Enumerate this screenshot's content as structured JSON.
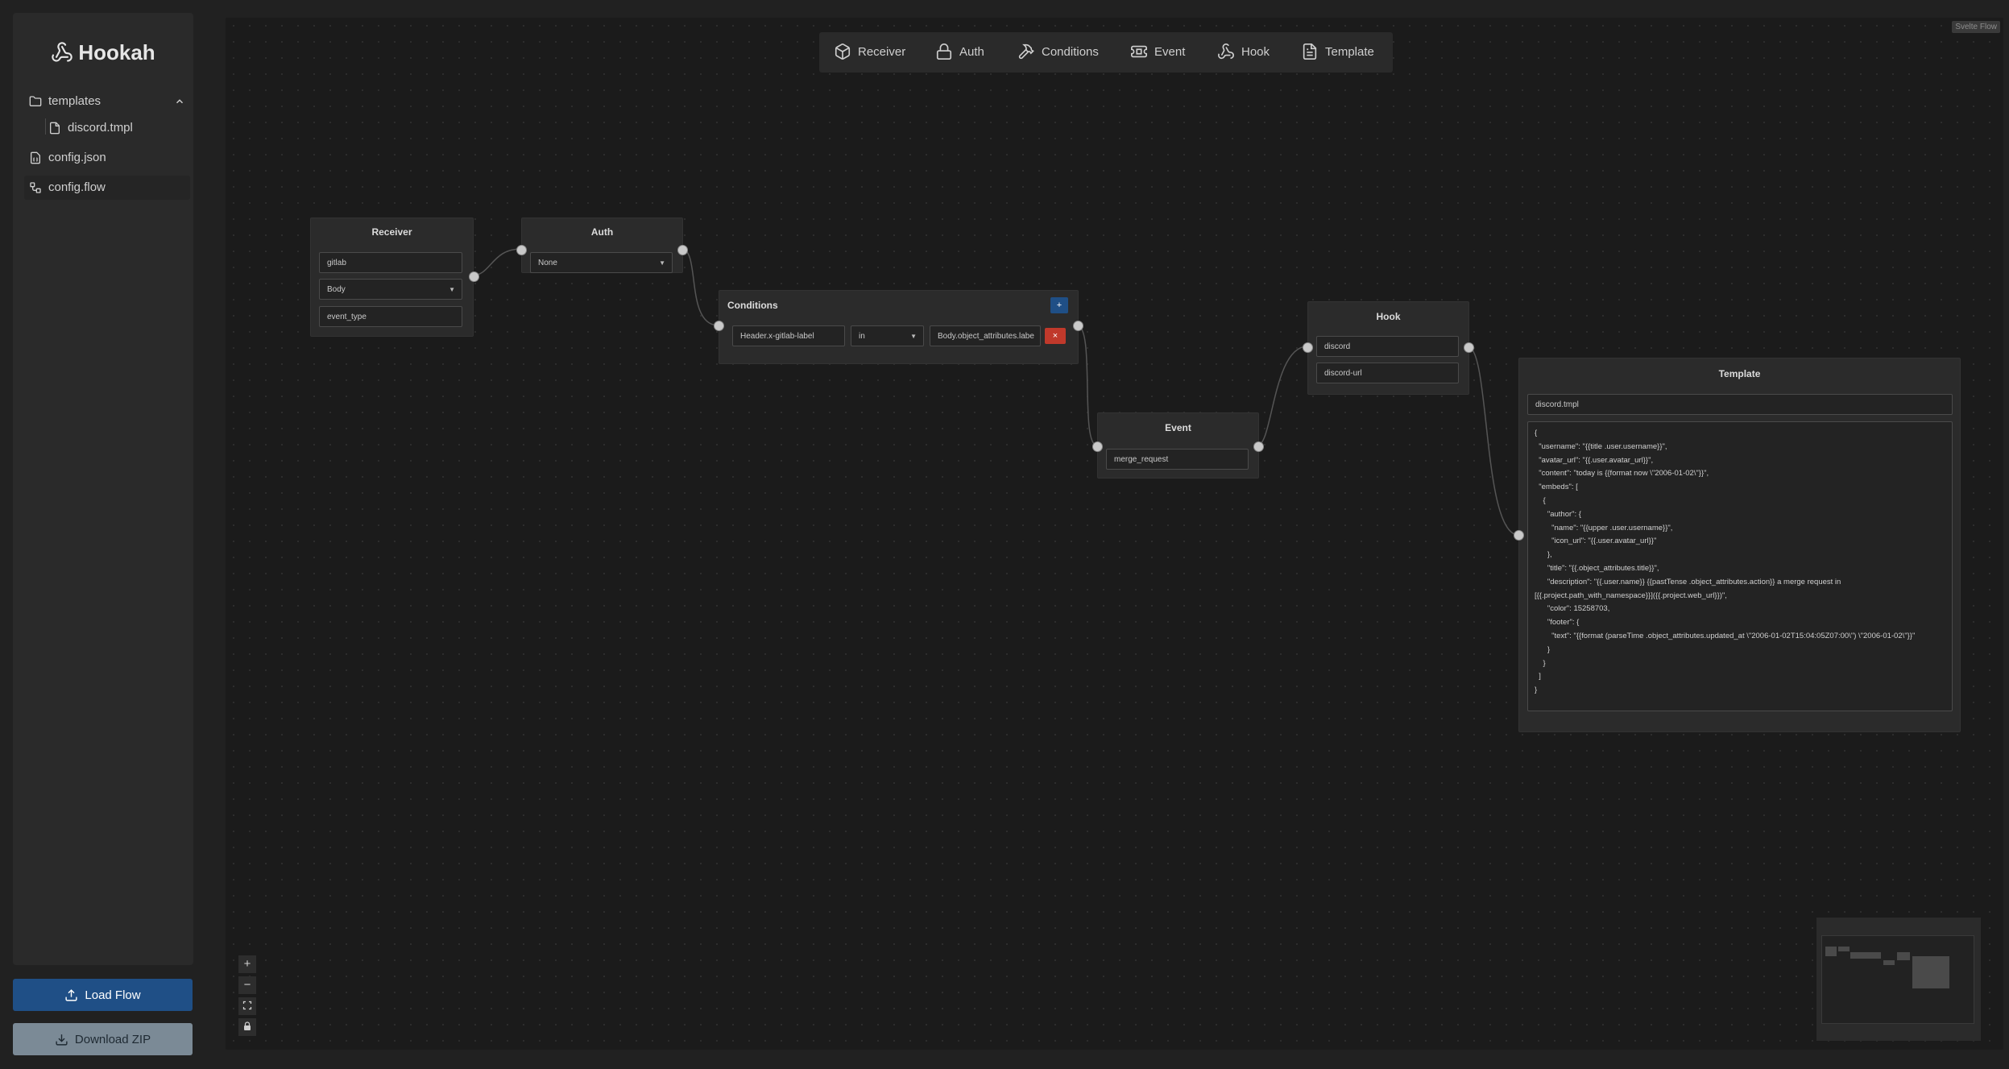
{
  "app": {
    "title": "Hookah"
  },
  "sidebar": {
    "tree": [
      {
        "label": "templates",
        "icon": "folder-icon",
        "expanded": true
      },
      {
        "label": "discord.tmpl",
        "icon": "file-icon"
      },
      {
        "label": "config.json",
        "icon": "file-json-icon"
      },
      {
        "label": "config.flow",
        "icon": "flow-icon",
        "active": true
      }
    ],
    "load_label": "Load Flow",
    "download_label": "Download ZIP"
  },
  "canvas": {
    "attribution": "Svelte Flow",
    "toolbar": [
      "Receiver",
      "Auth",
      "Conditions",
      "Event",
      "Hook",
      "Template"
    ],
    "controls": [
      "+",
      "−"
    ]
  },
  "nodes": {
    "receiver": {
      "title": "Receiver",
      "name": "gitlab",
      "source": "Body",
      "key": "event_type"
    },
    "auth": {
      "title": "Auth",
      "method": "None"
    },
    "conditions": {
      "title": "Conditions",
      "add": "+",
      "remove": "×",
      "left": "Header.x-gitlab-label",
      "op": "in",
      "right": "Body.object_attributes.labe"
    },
    "event": {
      "title": "Event",
      "value": "merge_request"
    },
    "hook": {
      "title": "Hook",
      "name": "discord",
      "url": "discord-url"
    },
    "template": {
      "title": "Template",
      "file": "discord.tmpl",
      "body": "{\n  \"username\": \"{{title .user.username}}\",\n  \"avatar_url\": \"{{.user.avatar_url}}\",\n  \"content\": \"today is {{format now \\\"2006-01-02\\\"}}\",\n  \"embeds\": [\n    {\n      \"author\": {\n        \"name\": \"{{upper .user.username}}\",\n        \"icon_url\": \"{{.user.avatar_url}}\"\n      },\n      \"title\": \"{{.object_attributes.title}}\",\n      \"description\": \"{{.user.name}} {{pastTense .object_attributes.action}} a merge request in\n[{{.project.path_with_namespace}}]({{.project.web_url}})\",\n      \"color\": 15258703,\n      \"footer\": {\n        \"text\": \"{{format (parseTime .object_attributes.updated_at \\\"2006-01-02T15:04:05Z07:00\\\") \\\"2006-01-02\\\"}}\"\n      }\n    }\n  ]\n}"
    }
  }
}
